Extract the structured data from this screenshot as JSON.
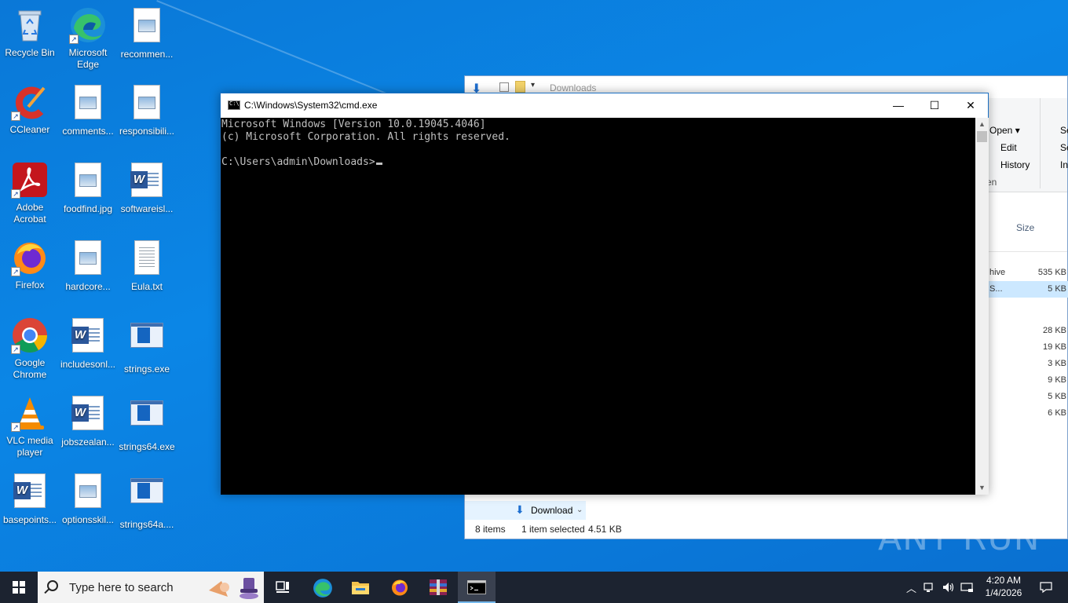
{
  "desktop": {
    "icons": [
      {
        "label": "Recycle Bin",
        "icon": "recycle-bin-icon"
      },
      {
        "label": "Microsoft Edge",
        "icon": "edge-icon"
      },
      {
        "label": "recommen...",
        "icon": "image-file-icon"
      },
      {
        "label": "CCleaner",
        "icon": "ccleaner-icon"
      },
      {
        "label": "comments...",
        "icon": "image-file-icon"
      },
      {
        "label": "responsibili...",
        "icon": "image-file-icon"
      },
      {
        "label": "Adobe Acrobat",
        "icon": "acrobat-icon"
      },
      {
        "label": "foodfind.jpg",
        "icon": "image-file-icon"
      },
      {
        "label": "softwareisl...",
        "icon": "word-doc-icon"
      },
      {
        "label": "Firefox",
        "icon": "firefox-icon"
      },
      {
        "label": "hardcore...",
        "icon": "image-file-icon"
      },
      {
        "label": "Eula.txt",
        "icon": "text-file-icon"
      },
      {
        "label": "Google Chrome",
        "icon": "chrome-icon"
      },
      {
        "label": "includesonl...",
        "icon": "word-doc-icon"
      },
      {
        "label": "strings.exe",
        "icon": "exe-icon"
      },
      {
        "label": "VLC media player",
        "icon": "vlc-icon"
      },
      {
        "label": "jobszealan...",
        "icon": "word-doc-icon"
      },
      {
        "label": "strings64.exe",
        "icon": "exe-icon"
      },
      {
        "label": "basepoints...",
        "icon": "word-doc-icon"
      },
      {
        "label": "optionsskil...",
        "icon": "image-file-icon"
      },
      {
        "label": "strings64a....",
        "icon": "exe-icon"
      }
    ]
  },
  "explorer": {
    "title": "Downloads",
    "ribbon": {
      "open": "Open",
      "edit": "Edit",
      "history": "History",
      "open_group": "en",
      "se1": "Se",
      "se2": "Se",
      "inv": "Inv"
    },
    "col_size": "Size",
    "rows": [
      {
        "name": "hive",
        "size": "535 KB"
      },
      {
        "name": "S...",
        "size": "5 KB",
        "selected": true
      },
      {
        "name": "",
        "size": "28 KB"
      },
      {
        "name": "",
        "size": "19 KB"
      },
      {
        "name": "",
        "size": "3 KB"
      },
      {
        "name": "",
        "size": "9 KB"
      },
      {
        "name": "",
        "size": "5 KB"
      },
      {
        "name": "",
        "size": "6 KB"
      }
    ],
    "nav_download": "Download",
    "status": {
      "items": "8 items",
      "selected": "1 item selected",
      "size": "4.51 KB"
    }
  },
  "cmd": {
    "title": "C:\\Windows\\System32\\cmd.exe",
    "line1": "Microsoft Windows [Version 10.0.19045.4046]",
    "line2": "(c) Microsoft Corporation. All rights reserved.",
    "prompt": "C:\\Users\\admin\\Downloads>"
  },
  "watermark": "ANY RUN",
  "taskbar": {
    "search_placeholder": "Type here to search",
    "clock_time": "4:20 AM",
    "clock_date": "1/4/2026",
    "pinned": [
      "task-view-icon",
      "edge-icon",
      "file-explorer-icon",
      "firefox-icon",
      "winrar-icon",
      "cmd-icon"
    ]
  },
  "colors": {
    "desktop_bg": "#0a78d7",
    "taskbar_bg": "#1c2330",
    "accent": "#76b9ed"
  }
}
